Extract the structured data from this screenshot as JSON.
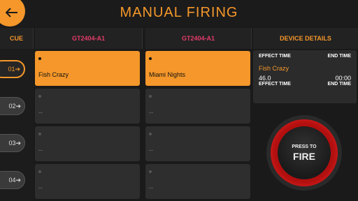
{
  "header": {
    "title": "MANUAL FIRING"
  },
  "columns": {
    "cue": "CUE",
    "device1": "GT2404-A1",
    "device2": "GT2404-A1",
    "details": "DEVICE DETAILS"
  },
  "cues": [
    {
      "label": "01"
    },
    {
      "label": "02"
    },
    {
      "label": "03"
    },
    {
      "label": "04"
    }
  ],
  "grid": {
    "device1": [
      "Fish Crazy",
      "--",
      "--",
      "--"
    ],
    "device2": [
      "Miami Nights",
      "--",
      "--",
      "--"
    ]
  },
  "details": {
    "effect_time_label": "EFFECT TIME",
    "end_time_label": "END TIME",
    "name": "Fish Crazy",
    "effect_time_value": "46.0",
    "end_time_value": "00:00",
    "effect_time_label2": "EFFECT TIME",
    "end_time_label2": "END TIME"
  },
  "fire": {
    "line1": "PRESS TO",
    "line2": "FIRE"
  },
  "colors": {
    "accent": "#f5972a",
    "device": "#e23b6a",
    "fire_ring": "#b01010"
  }
}
